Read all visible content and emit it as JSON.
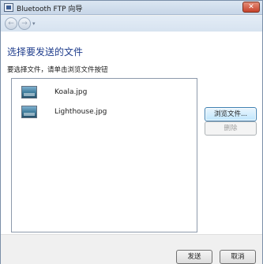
{
  "window": {
    "title": "Bluetooth FTP 向导",
    "close_glyph": "✕"
  },
  "nav": {
    "back_glyph": "←",
    "forward_glyph": "→",
    "dropdown_glyph": "▾"
  },
  "page": {
    "heading": "选择要发送的文件",
    "instruction": "要选择文件，请单击浏览文件按钮"
  },
  "files": [
    {
      "name": "Koala.jpg",
      "icon": "image-file-icon"
    },
    {
      "name": "Lighthouse.jpg",
      "icon": "image-file-icon"
    }
  ],
  "buttons": {
    "browse": "浏览文件...",
    "delete": "删除",
    "send": "发送",
    "cancel": "取消"
  }
}
